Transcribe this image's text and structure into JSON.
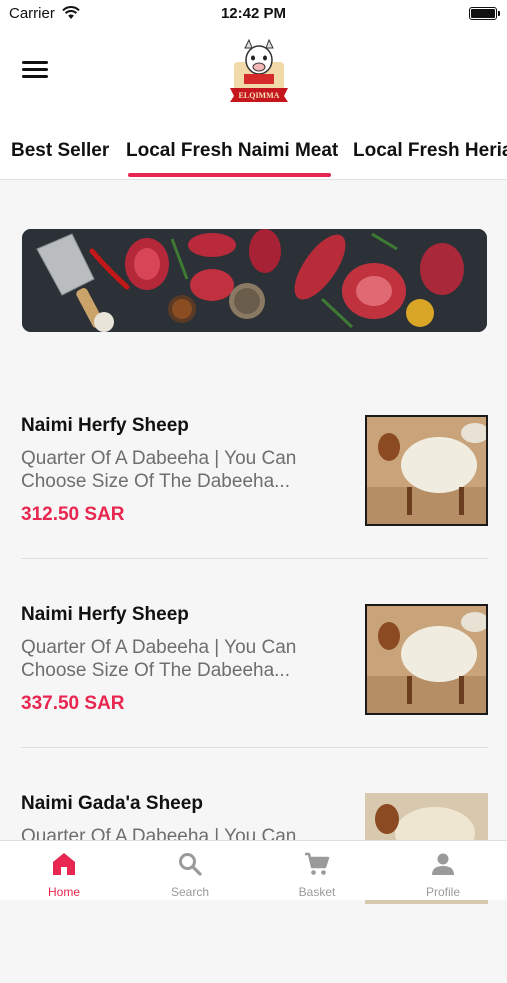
{
  "status_bar": {
    "carrier": "Carrier",
    "time": "12:42 PM"
  },
  "header": {
    "logo_text": "ELQIMMA"
  },
  "tabs": [
    {
      "label": "Best Seller",
      "active": false
    },
    {
      "label": "Local Fresh Naimi Meat",
      "active": true
    },
    {
      "label": "Local Fresh Heria",
      "active": false
    }
  ],
  "products": [
    {
      "name": "Naimi Herfy Sheep",
      "description": "Quarter Of A Dabeeha | You Can Choose Size Of The Dabeeha...",
      "price": "312.50 SAR"
    },
    {
      "name": "Naimi Herfy Sheep",
      "description": "Quarter Of A Dabeeha | You Can Choose Size Of The Dabeeha...",
      "price": "337.50 SAR"
    },
    {
      "name": "Naimi Gada'a Sheep",
      "description": "Quarter Of A Dabeeha | You Can",
      "price": ""
    }
  ],
  "bottom_nav": [
    {
      "label": "Home",
      "icon": "home-icon",
      "active": true
    },
    {
      "label": "Search",
      "icon": "search-icon",
      "active": false
    },
    {
      "label": "Basket",
      "icon": "cart-icon",
      "active": false
    },
    {
      "label": "Profile",
      "icon": "person-icon",
      "active": false
    }
  ],
  "colors": {
    "accent": "#e8264f",
    "inactive": "#9a9a9a",
    "background": "#f6f6f6"
  }
}
